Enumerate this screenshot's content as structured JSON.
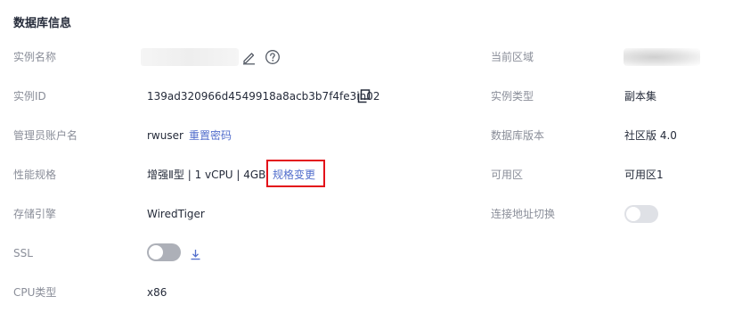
{
  "section": {
    "title": "数据库信息"
  },
  "left": {
    "instance_name_label": "实例名称",
    "instance_id_label": "实例ID",
    "instance_id_value": "139ad320966d4549918a8acb3b7f4fe3in02",
    "admin_label": "管理员账户名",
    "admin_value": "rwuser",
    "reset_password": "重置密码",
    "spec_label": "性能规格",
    "spec_value": "增强Ⅱ型 | 1 vCPU | 4GB",
    "spec_change": "规格变更",
    "storage_label": "存储引擎",
    "storage_value": "WiredTiger",
    "ssl_label": "SSL",
    "cpu_label": "CPU类型",
    "cpu_value": "x86"
  },
  "right": {
    "region_label": "当前区域",
    "type_label": "实例类型",
    "type_value": "副本集",
    "version_label": "数据库版本",
    "version_value": "社区版 4.0",
    "az_label": "可用区",
    "az_value": "可用区1",
    "switch_label": "连接地址切换"
  },
  "icons": {
    "edit": "edit-icon",
    "help": "help-icon",
    "copy": "copy-icon",
    "download": "download-icon"
  },
  "colors": {
    "link": "#526ecc",
    "highlight": "#e3121a",
    "label": "#8a8e99",
    "text": "#252b3a"
  }
}
